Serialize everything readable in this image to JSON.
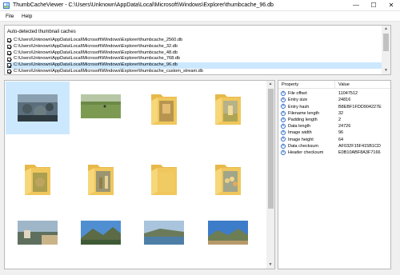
{
  "window": {
    "title": "ThumbCacheViewer - C:\\Users\\Unknown\\AppData\\Local\\Microsoft\\Windows\\Explorer\\thumbcache_96.db",
    "minimize_glyph": "—",
    "maximize_glyph": "☐",
    "close_glyph": "✕"
  },
  "menu": {
    "file": "File",
    "help": "Help"
  },
  "caches": {
    "header": "Auto-detected thumbnail caches",
    "items": [
      {
        "path": "C:\\Users\\Unknown\\AppData\\Local\\Microsoft\\Windows\\Explorer\\thumbcache_2560.db",
        "checked": true,
        "selected": false
      },
      {
        "path": "C:\\Users\\Unknown\\AppData\\Local\\Microsoft\\Windows\\Explorer\\thumbcache_32.db",
        "checked": true,
        "selected": false
      },
      {
        "path": "C:\\Users\\Unknown\\AppData\\Local\\Microsoft\\Windows\\Explorer\\thumbcache_48.db",
        "checked": true,
        "selected": false
      },
      {
        "path": "C:\\Users\\Unknown\\AppData\\Local\\Microsoft\\Windows\\Explorer\\thumbcache_768.db",
        "checked": true,
        "selected": false
      },
      {
        "path": "C:\\Users\\Unknown\\AppData\\Local\\Microsoft\\Windows\\Explorer\\thumbcache_96.db",
        "checked": true,
        "selected": true
      },
      {
        "path": "C:\\Users\\Unknown\\AppData\\Local\\Microsoft\\Windows\\Explorer\\thumbcache_custom_stream.db",
        "checked": true,
        "selected": false
      }
    ]
  },
  "thumbnails": [
    {
      "kind": "photo-rocks",
      "selected": true
    },
    {
      "kind": "photo-field",
      "selected": false
    },
    {
      "kind": "folder-bird",
      "selected": false
    },
    {
      "kind": "folder-landscape",
      "selected": false
    },
    {
      "kind": "folder-rock",
      "selected": false
    },
    {
      "kind": "folder-people",
      "selected": false
    },
    {
      "kind": "folder-plain",
      "selected": false
    },
    {
      "kind": "folder-crowd",
      "selected": false
    },
    {
      "kind": "photo-road",
      "selected": false
    },
    {
      "kind": "photo-mountain",
      "selected": false
    },
    {
      "kind": "photo-lake",
      "selected": false
    },
    {
      "kind": "photo-hills",
      "selected": false
    }
  ],
  "properties": {
    "col_property": "Property",
    "col_value": "Value",
    "rows": [
      {
        "name": "File offset",
        "value": "11047512"
      },
      {
        "name": "Entry size",
        "value": "24816"
      },
      {
        "name": "Entry hash",
        "value": "B8EBF1FDD904227E"
      },
      {
        "name": "Filename length",
        "value": "32"
      },
      {
        "name": "Padding length",
        "value": "2"
      },
      {
        "name": "Data length",
        "value": "24726"
      },
      {
        "name": "Image width",
        "value": "96"
      },
      {
        "name": "Image height",
        "value": "64"
      },
      {
        "name": "Data checksum",
        "value": "AF032F15F415B1CD"
      },
      {
        "name": "Header checksum",
        "value": "E0B10ABF8A3F7166"
      }
    ]
  },
  "colors": {
    "selection": "#cce8ff",
    "info_icon": "#2e6bc6",
    "folder": "#f5d36b"
  }
}
